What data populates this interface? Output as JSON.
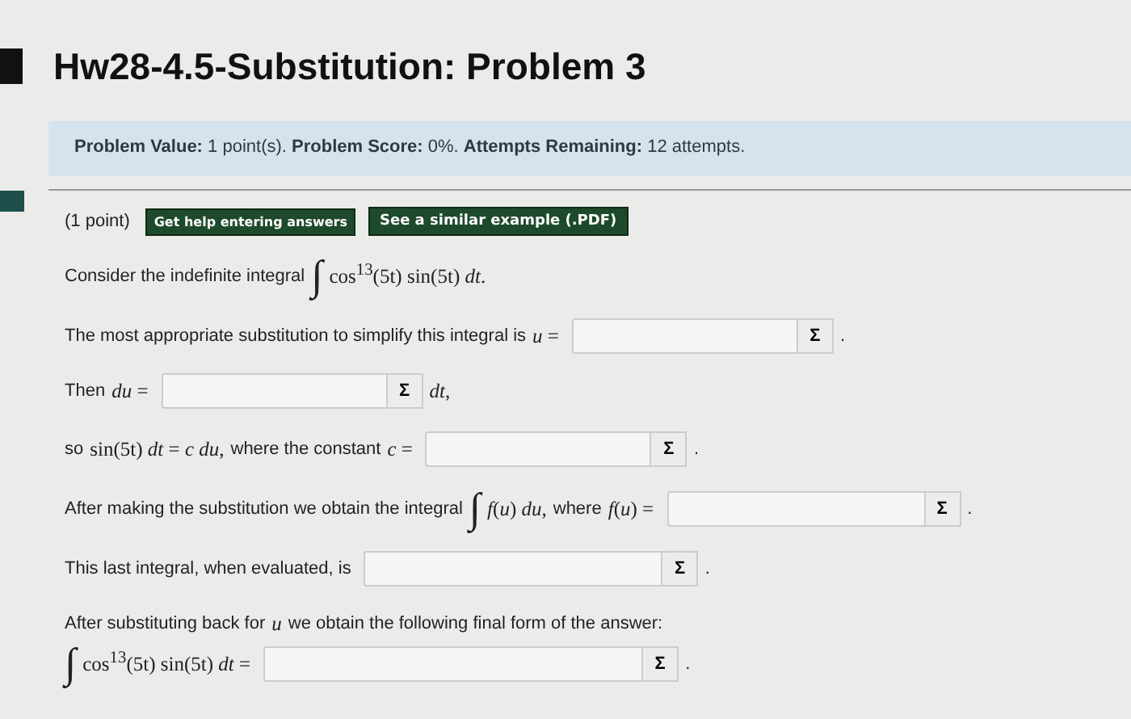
{
  "title": "Hw28-4.5-Substitution: Problem 3",
  "info": "**Problem Value:** 1 point(s). **Problem Score:** 0%. **Attempts Remaining:** 12 attempts.",
  "points": "(1 point)",
  "buttons": [
    "Get help entering answers",
    "See a similar example (.PDF)"
  ],
  "lines": [
    {
      "parts": [
        {
          "kind": "text",
          "text": "Consider the indefinite integral"
        },
        {
          "kind": "integral",
          "text": "∫"
        },
        {
          "kind": "math",
          "text": "cos$^{13}$(5t) sin(5t) *dt*."
        }
      ]
    },
    {
      "parts": [
        {
          "kind": "text",
          "text": "The most appropriate substitution to simplify this integral is"
        },
        {
          "kind": "math",
          "text": "*u* ="
        },
        {
          "kind": "field",
          "button": "Σ"
        },
        {
          "kind": "text",
          "text": "."
        }
      ]
    },
    {
      "parts": [
        {
          "kind": "text",
          "text": "Then"
        },
        {
          "kind": "math",
          "text": "*du* ="
        },
        {
          "kind": "field",
          "button": "Σ"
        },
        {
          "kind": "math",
          "text": "*dt*,"
        }
      ]
    },
    {
      "parts": [
        {
          "kind": "text",
          "text": "so"
        },
        {
          "kind": "math",
          "text": "sin(5t) *dt* = *c du*,"
        },
        {
          "kind": "text",
          "text": "where the constant"
        },
        {
          "kind": "math",
          "text": "*c* ="
        },
        {
          "kind": "field",
          "button": "Σ"
        },
        {
          "kind": "text",
          "text": "."
        }
      ]
    },
    {
      "parts": [
        {
          "kind": "text",
          "text": "After making the substitution we obtain the integral"
        },
        {
          "kind": "integral",
          "text": "∫"
        },
        {
          "kind": "math",
          "text": "*f*(*u*) *du*,"
        },
        {
          "kind": "text",
          "text": "where"
        },
        {
          "kind": "math",
          "text": "*f*(*u*) ="
        },
        {
          "kind": "field",
          "button": "Σ"
        },
        {
          "kind": "text",
          "text": "."
        }
      ]
    },
    {
      "parts": [
        {
          "kind": "text",
          "text": "This last integral, when evaluated, is"
        },
        {
          "kind": "field",
          "button": "Σ"
        },
        {
          "kind": "text",
          "text": "."
        }
      ]
    },
    {
      "parts": [
        {
          "kind": "text",
          "text": "After substituting back for"
        },
        {
          "kind": "math",
          "text": "*u*"
        },
        {
          "kind": "text",
          "text": "we obtain the following final form of the answer:"
        }
      ]
    },
    {
      "parts": [
        {
          "kind": "integral",
          "text": "∫"
        },
        {
          "kind": "math",
          "text": "cos$^{13}$(5t) sin(5t) *dt* ="
        },
        {
          "kind": "field",
          "button": "Σ"
        },
        {
          "kind": "text",
          "text": "."
        }
      ]
    }
  ]
}
